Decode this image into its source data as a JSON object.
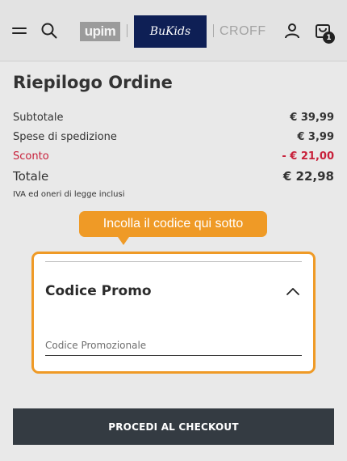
{
  "header": {
    "icons": [
      "menu-icon",
      "search-icon",
      "user-icon",
      "cart-icon"
    ],
    "brands": {
      "upim": "upim",
      "bukids": "BuKids",
      "croff": "CROFF"
    },
    "cart_count": "1"
  },
  "summary": {
    "title": "Riepilogo Ordine",
    "subtotal_label": "Subtotale",
    "subtotal_value": "€ 39,99",
    "shipping_label": "Spese di spedizione",
    "shipping_value": "€ 3,99",
    "discount_label": "Sconto",
    "discount_value": "- € 21,00",
    "total_label": "Totale",
    "total_value": "€ 22,98",
    "tax_note": "IVA ed oneri di legge inclusi"
  },
  "tooltip": {
    "text": "Incolla il codice qui sotto"
  },
  "promo": {
    "title": "Codice Promo",
    "input_placeholder": "Codice Promozionale",
    "input_value": ""
  },
  "checkout": {
    "label": "PROCEDI AL CHECKOUT"
  },
  "colors": {
    "accent_orange": "#ef9a26",
    "discount_red": "#c8203a",
    "checkout_bg": "#343b42",
    "bukids_navy": "#0e1f55"
  }
}
